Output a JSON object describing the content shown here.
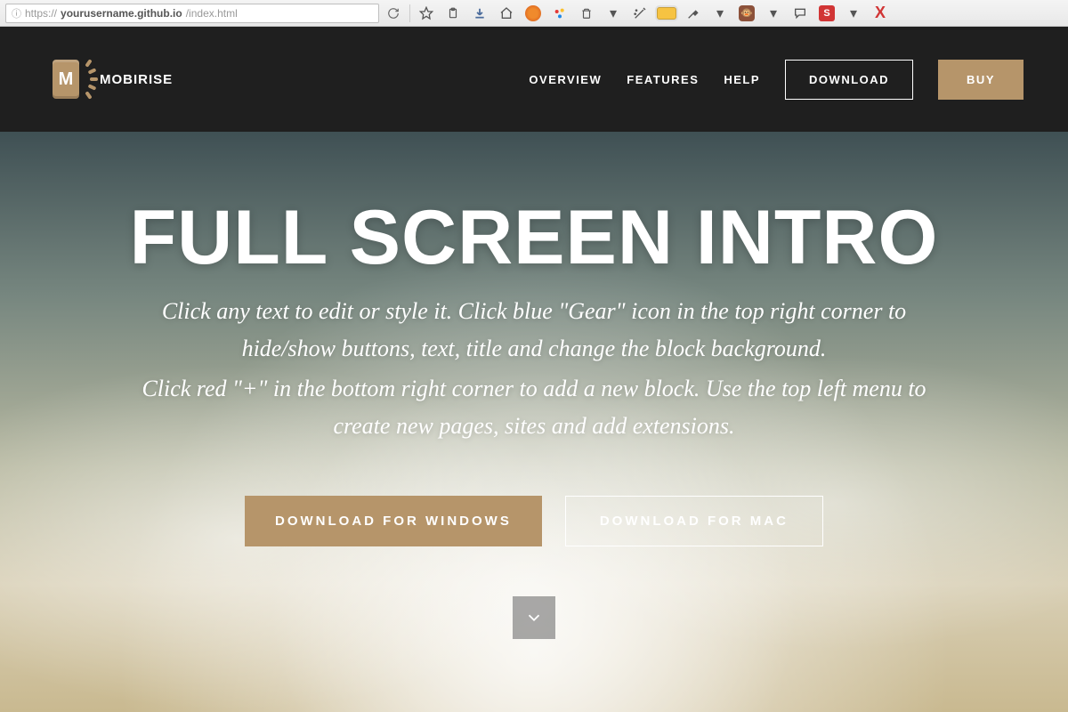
{
  "browser": {
    "url_domain": "yourusername.github.io",
    "url_path": "/index.html",
    "url_prefix": "https://"
  },
  "nav": {
    "brand": "MOBIRISE",
    "links": {
      "overview": "OVERVIEW",
      "features": "FEATURES",
      "help": "HELP"
    },
    "download": "DOWNLOAD",
    "buy": "BUY"
  },
  "hero": {
    "title": "FULL SCREEN INTRO",
    "subtitle1": "Click any text to edit or style it. Click blue \"Gear\" icon in the top right corner to hide/show buttons, text, title and change the block background.",
    "subtitle2": "Click red \"+\" in the bottom right corner to add a new block. Use the top left menu to create new pages, sites and add extensions.",
    "cta_windows": "DOWNLOAD FOR WINDOWS",
    "cta_mac": "DOWNLOAD FOR MAC"
  },
  "colors": {
    "accent": "#b6956a",
    "navbar": "#1f1f1f"
  }
}
